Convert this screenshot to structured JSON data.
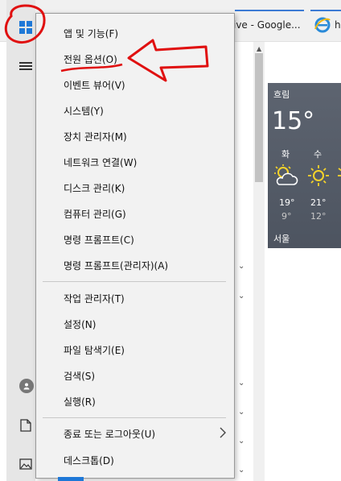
{
  "taskbar": {
    "tabs": [
      {
        "label": "ive - Google..."
      },
      {
        "label": "h"
      }
    ]
  },
  "rail": {
    "start_icon": "windows-logo-icon",
    "menu_icon": "hamburger-icon",
    "user_icon": "user-avatar-icon",
    "documents_icon": "document-icon",
    "pictures_icon": "pictures-icon"
  },
  "context_menu": {
    "items_group1": [
      {
        "label": "앱 및 기능(F)"
      },
      {
        "label": "전원 옵션(O)"
      },
      {
        "label": "이벤트 뷰어(V)"
      },
      {
        "label": "시스템(Y)"
      },
      {
        "label": "장치 관리자(M)"
      },
      {
        "label": "네트워크 연결(W)"
      },
      {
        "label": "디스크 관리(K)"
      },
      {
        "label": "컴퓨터 관리(G)"
      },
      {
        "label": "명령 프롬프트(C)"
      },
      {
        "label": "명령 프롬프트(관리자)(A)"
      }
    ],
    "items_group2": [
      {
        "label": "작업 관리자(T)"
      },
      {
        "label": "설정(N)"
      },
      {
        "label": "파일 탐색기(E)"
      },
      {
        "label": "검색(S)"
      },
      {
        "label": "실행(R)"
      }
    ],
    "items_group3": [
      {
        "label": "종료 또는 로그아웃(U)",
        "submenu_icon": "chevron-right-icon"
      },
      {
        "label": "데스크톱(D)"
      }
    ]
  },
  "weather": {
    "condition": "흐림",
    "temperature": "15°",
    "days": [
      {
        "day": "화",
        "icon": "partly-cloudy-icon",
        "high": "19°",
        "low": "9°"
      },
      {
        "day": "수",
        "icon": "sunny-icon",
        "high": "21°",
        "low": "12°"
      }
    ],
    "city": "서울"
  },
  "colors": {
    "accent": "#1e78d7",
    "annotation": "#e01010",
    "menu_bg": "#f2f2f2",
    "weather_bg": "#565d69"
  }
}
